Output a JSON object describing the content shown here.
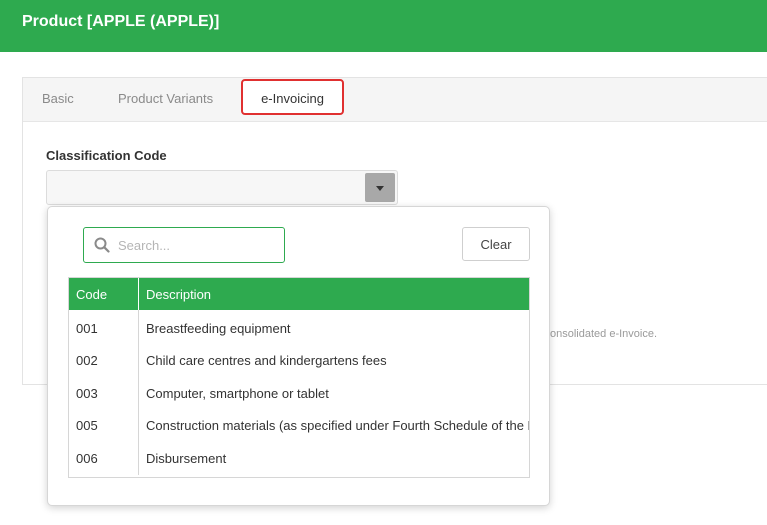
{
  "header": {
    "title": "Product [APPLE (APPLE)]"
  },
  "tabs": [
    {
      "label": "Basic"
    },
    {
      "label": "Product Variants"
    },
    {
      "label": "e-Invoicing"
    }
  ],
  "form": {
    "classification_label": "Classification Code",
    "hint_text": "onsolidated e-Invoice."
  },
  "dropdown": {
    "search_placeholder": "Search...",
    "clear_label": "Clear",
    "columns": [
      "Code",
      "Description"
    ],
    "rows": [
      {
        "code": "001",
        "description": "Breastfeeding equipment"
      },
      {
        "code": "002",
        "description": "Child care centres and kindergartens fees"
      },
      {
        "code": "003",
        "description": "Computer, smartphone or tablet"
      },
      {
        "code": "005",
        "description": "Construction materials (as specified under Fourth Schedule of the L"
      },
      {
        "code": "006",
        "description": "Disbursement"
      }
    ]
  },
  "colors": {
    "accent": "#2eaa4f",
    "highlight_border": "#e03030"
  }
}
